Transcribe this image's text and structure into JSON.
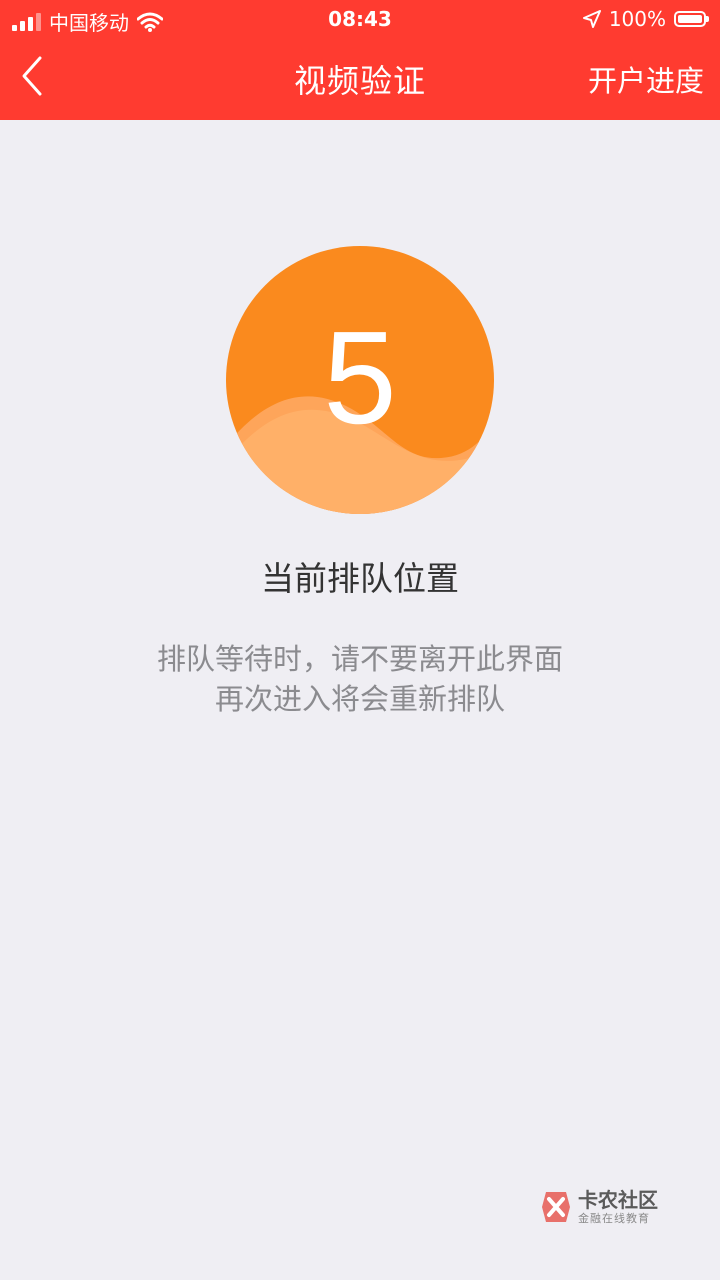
{
  "status_bar": {
    "carrier": "中国移动",
    "time": "08:43",
    "battery": "100%"
  },
  "nav": {
    "title": "视频验证",
    "right_action": "开户进度"
  },
  "queue": {
    "position": "5",
    "label": "当前排队位置",
    "hint_line1": "排队等待时，请不要离开此界面",
    "hint_line2": "再次进入将会重新排队"
  },
  "watermark": {
    "name": "卡农社区",
    "subtitle": "金融在线教育"
  },
  "colors": {
    "nav_bar": "#ff3b30",
    "background": "#efeef3",
    "circle": "#fa8a1e",
    "wave_light": "#ffb066"
  },
  "icons": {
    "back": "chevron-left-icon",
    "wifi": "wifi-icon",
    "location": "location-arrow-icon",
    "battery": "battery-icon"
  }
}
